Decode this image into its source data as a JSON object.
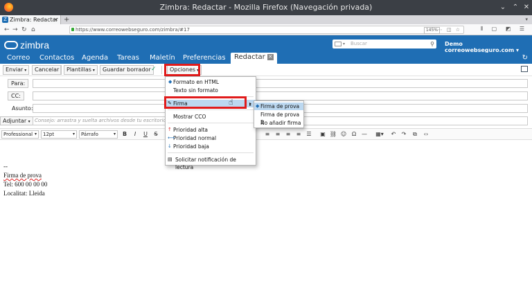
{
  "browser": {
    "window_title": "Zimbra: Redactar - Mozilla Firefox (Navegación privada)",
    "tab_title": "Zimbra: Redactar",
    "url": "https://www.correowebseguro.com/zimbra/#17",
    "zoom": "145%"
  },
  "zimbra": {
    "logo_text": "zimbra",
    "search_placeholder": "Buscar",
    "user": "Demo correowebseguro.com",
    "accent_color": "#1f6eb4"
  },
  "app_tabs": [
    "Correo",
    "Contactos",
    "Agenda",
    "Tareas",
    "Maletín",
    "Preferencias",
    "Redactar"
  ],
  "toolbar": {
    "send": "Enviar",
    "cancel": "Cancelar",
    "templates": "Plantillas",
    "save_draft": "Guardar borrador",
    "options": "Opciones"
  },
  "fields": {
    "to": "Para:",
    "cc": "CC:",
    "subject": "Asunto:",
    "attach": "Adjuntar",
    "attach_hint": "Consejo: arrastra y suelta archivos desde tu escritorio pa"
  },
  "format": {
    "font": "Professional",
    "size": "12pt",
    "block": "Párrafo"
  },
  "editor": {
    "lines": [
      "--",
      "Firma de prova",
      "Tel: 600 00 00 00",
      "Localitat: Lleida"
    ]
  },
  "options_menu": {
    "html": "Formato en HTML",
    "plain": "Texto sin formato",
    "signature": "Firma",
    "show_bcc": "Mostrar CCO",
    "high": "Prioridad alta",
    "normal": "Prioridad normal",
    "low": "Prioridad baja",
    "read_receipt": "Solicitar notificación de lectura"
  },
  "signature_submenu": [
    "Firma de prova",
    "Firma de prova 2",
    "No añadir firma"
  ],
  "highlight_color": "#e01b1b"
}
